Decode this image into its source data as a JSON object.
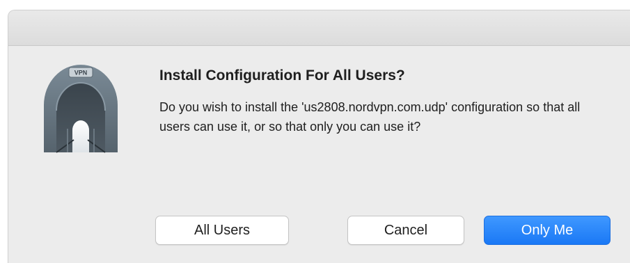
{
  "dialog": {
    "icon": "vpn-tunnel-icon",
    "icon_badge": "VPN",
    "title": "Install Configuration For All Users?",
    "message": "Do you wish to install the 'us2808.nordvpn.com.udp' configuration so that all users can use it, or so that only you can use it?"
  },
  "buttons": {
    "all_users": "All Users",
    "cancel": "Cancel",
    "only_me": "Only Me"
  },
  "colors": {
    "primary_button": "#1a78f5",
    "dialog_background": "#ececec"
  }
}
